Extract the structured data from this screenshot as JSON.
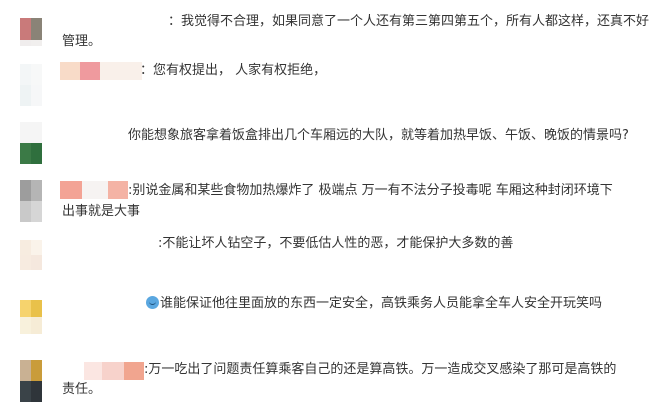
{
  "comments": [
    {
      "avatar": [
        "#c97a7a",
        "#8a8377",
        "#f0eded",
        "#f1efee"
      ],
      "name_blocks": [],
      "text": "：我觉得不合理，如果同意了一个人还有第三第四第五个，所有人都这样，还真不好管理。",
      "line1": "：我觉得不合理，如果同意了一个人还有第三第四第五个，所有人都这样，还真不好",
      "line2": "管理。"
    },
    {
      "avatar": [
        "#f3f6f7",
        "#f7f8f8",
        "#eef3f4",
        "#f6f7f8"
      ],
      "name_blocks": [
        "#f8dbc8",
        "#ef9a9e",
        "#f9f0ea"
      ],
      "text": "：您有权提出， 人家有权拒绝，",
      "line1": "：您有权提出， 人家有权拒绝，",
      "line2": ""
    },
    {
      "avatar": [
        "#f5f5f5",
        "#f5f5f5",
        "#3b7a46",
        "#2f6f3d"
      ],
      "name_blocks": [],
      "text": "你能想象旅客拿着饭盒排出几个车厢远的大队，就等着加热早饭、午饭、晚饭的情景吗?",
      "line1": "你能想象旅客拿着饭盒排出几个车厢远的大队，就等着加热早饭、午饭、晚饭的情景吗?",
      "line2": ""
    },
    {
      "avatar": [
        "#9d9d9d",
        "#b5b5b5",
        "#c9c9c9",
        "#d6d6d6"
      ],
      "name_blocks": [
        "#f3a395",
        "#f6f3f2",
        "#f4b3a5"
      ],
      "text": ":别说金属和某些食物加热爆炸了 极端点 万一有不法分子投毒呢 车厢这种封闭环境下出事就是大事",
      "line1": ":别说金属和某些食物加热爆炸了 极端点 万一有不法分子投毒呢 车厢这种封闭环境下",
      "line2": "出事就是大事"
    },
    {
      "avatar": [
        "#f7ece0",
        "#faf3ea",
        "#f7ebe0",
        "#f5e8de"
      ],
      "name_blocks": [],
      "text": ":不能让坏人钻空子，不要低估人性的恶，才能保护大多数的善",
      "line1": ":不能让坏人钻空子，不要低估人性的恶，才能保护大多数的善",
      "line2": ""
    },
    {
      "avatar": [
        "#f6d36d",
        "#e9c14a",
        "#f8f1dc",
        "#f6ecd6"
      ],
      "name_blocks": [],
      "emoji": "smile-emoji",
      "text": "谁能保证他往里面放的东西一定安全，高铁乘务人员能拿全车人安全开玩笑吗",
      "line1": "谁能保证他往里面放的东西一定安全，高铁乘务人员能拿全车人安全开玩笑吗",
      "line2": ""
    },
    {
      "avatar": [
        "#c9b193",
        "#c99c3a",
        "#3a4348",
        "#2f353a"
      ],
      "name_blocks": [
        "#fbe6e2",
        "#f7d2cb",
        "#f1a58f"
      ],
      "text": ":万一吃出了问题责任算乘客自己的还是算高铁。万一造成交叉感染了那可是高铁的责任。",
      "line1": ":万一吃出了问题责任算乘客自己的还是算高铁。万一造成交叉感染了那可是高铁的",
      "line2": "责任。"
    }
  ]
}
